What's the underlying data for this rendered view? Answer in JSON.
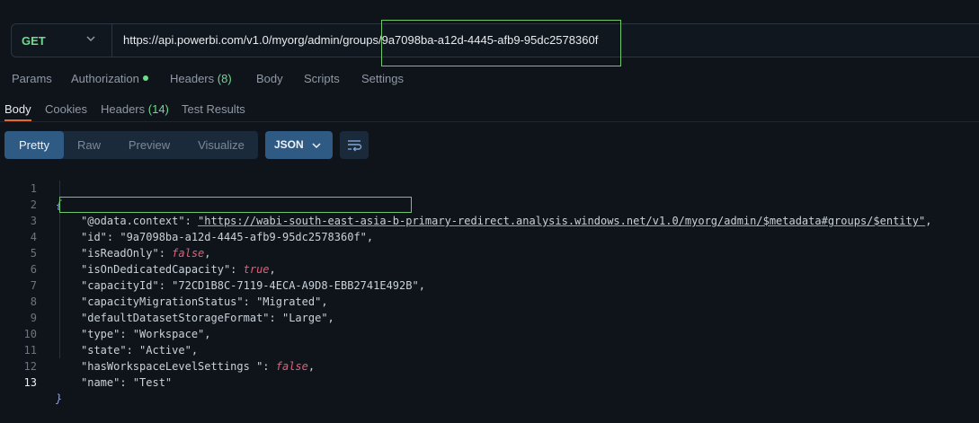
{
  "request": {
    "method": "GET",
    "url_base": "https://api.powerbi.com/v1.0/myorg/admin/groups/",
    "url_id": "9a7098ba-a12d-4445-afb9-95dc2578360f"
  },
  "request_tabs": [
    {
      "label": "Params",
      "count": ""
    },
    {
      "label": "Authorization",
      "count": ""
    },
    {
      "label": "Headers",
      "count": "(8)"
    },
    {
      "label": "Body",
      "count": ""
    },
    {
      "label": "Scripts",
      "count": ""
    },
    {
      "label": "Settings",
      "count": ""
    }
  ],
  "response_tabs": [
    {
      "label": "Body",
      "count": ""
    },
    {
      "label": "Cookies",
      "count": ""
    },
    {
      "label": "Headers",
      "count": "(14)"
    },
    {
      "label": "Test Results",
      "count": ""
    }
  ],
  "view_modes": [
    "Pretty",
    "Raw",
    "Preview",
    "Visualize"
  ],
  "format": "JSON",
  "icons": {
    "method_chevron": "chevron-down-icon",
    "format_chevron": "chevron-down-icon",
    "wrap": "wrap-lines-icon",
    "auth_dot": "status-dot-icon"
  },
  "colors": {
    "method": "#6bdd8b",
    "accent_tab": "#e36a2d",
    "active_button": "#2e5a84",
    "highlight_box": "#6fc86b",
    "bool": "#e45e78"
  },
  "code": {
    "open": "{",
    "close": "}",
    "fields": [
      {
        "key": "\"@odata.context\"",
        "value": "\"https://wabi-south-east-asia-b-primary-redirect.analysis.windows.net/v1.0/myorg/admin/$metadata#groups/$entity\"",
        "comma": ","
      },
      {
        "key": "\"id\"",
        "value": "\"9a7098ba-a12d-4445-afb9-95dc2578360f\"",
        "comma": ","
      },
      {
        "key": "\"isReadOnly\"",
        "value": "false",
        "comma": ","
      },
      {
        "key": "\"isOnDedicatedCapacity\"",
        "value": "true",
        "comma": ","
      },
      {
        "key": "\"capacityId\"",
        "value": "\"72CD1B8C-7119-4ECA-A9D8-EBB2741E492B\"",
        "comma": ","
      },
      {
        "key": "\"capacityMigrationStatus\"",
        "value": "\"Migrated\"",
        "comma": ","
      },
      {
        "key": "\"defaultDatasetStorageFormat\"",
        "value": "\"Large\"",
        "comma": ","
      },
      {
        "key": "\"type\"",
        "value": "\"Workspace\"",
        "comma": ","
      },
      {
        "key": "\"state\"",
        "value": "\"Active\"",
        "comma": ","
      },
      {
        "key": "\"hasWorkspaceLevelSettings \"",
        "value": "false",
        "comma": ","
      },
      {
        "key": "\"name\"",
        "value": "\"Test\"",
        "comma": ""
      }
    ],
    "line_numbers": [
      "1",
      "2",
      "3",
      "4",
      "5",
      "6",
      "7",
      "8",
      "9",
      "10",
      "11",
      "12",
      "13"
    ]
  }
}
